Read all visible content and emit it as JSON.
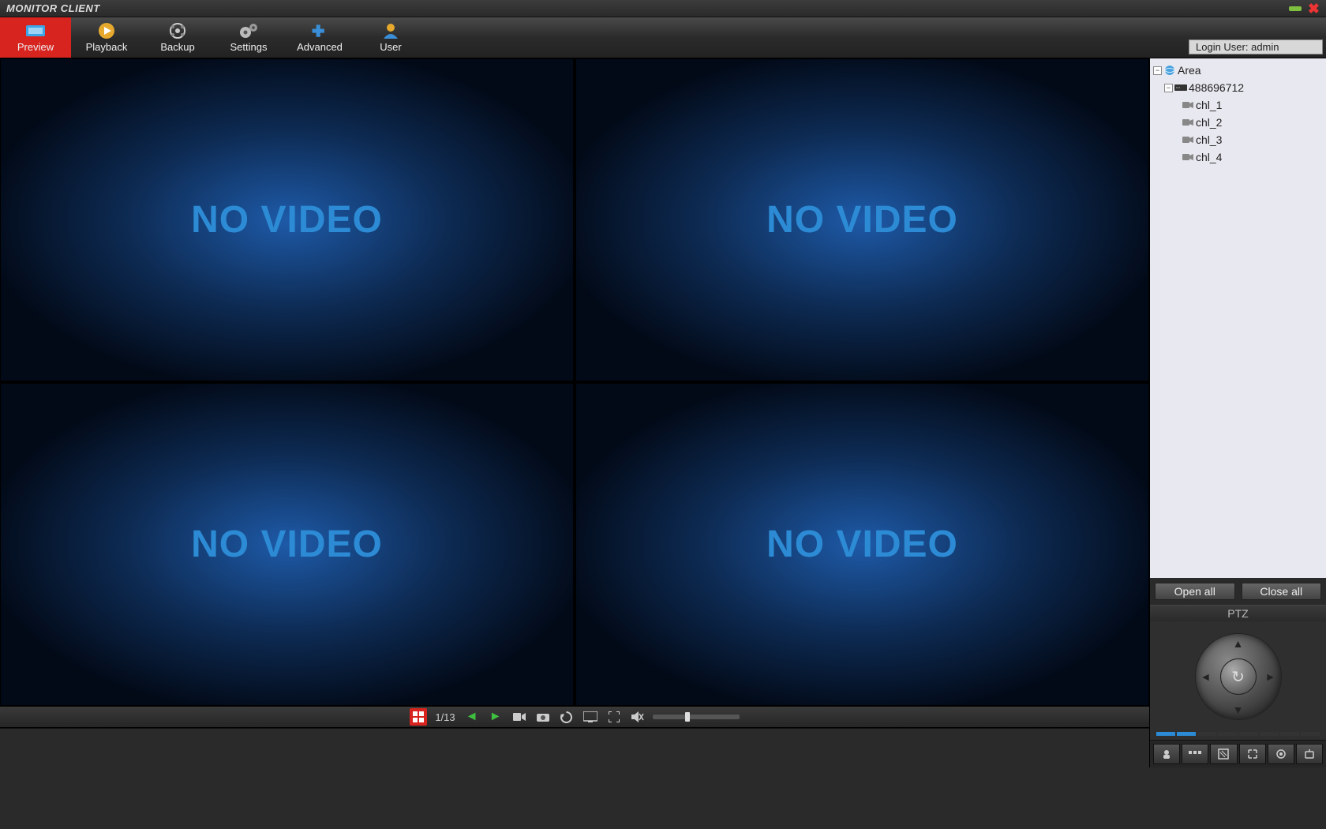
{
  "app_title": "MONITOR CLIENT",
  "toolbar": {
    "items": [
      {
        "label": "Preview",
        "icon": "preview-icon",
        "active": true
      },
      {
        "label": "Playback",
        "icon": "playback-icon",
        "active": false
      },
      {
        "label": "Backup",
        "icon": "backup-icon",
        "active": false
      },
      {
        "label": "Settings",
        "icon": "settings-icon",
        "active": false
      },
      {
        "label": "Advanced",
        "icon": "advanced-icon",
        "active": false
      },
      {
        "label": "User",
        "icon": "user-icon",
        "active": false
      }
    ]
  },
  "login_label": "Login User: admin",
  "video": {
    "placeholder": "NO VIDEO",
    "page_indicator": "1/13"
  },
  "tree": {
    "root": "Area",
    "device": "488696712",
    "channels": [
      "chl_1",
      "chl_2",
      "chl_3",
      "chl_4"
    ]
  },
  "buttons": {
    "open_all": "Open all",
    "close_all": "Close all"
  },
  "ptz": {
    "title": "PTZ"
  }
}
